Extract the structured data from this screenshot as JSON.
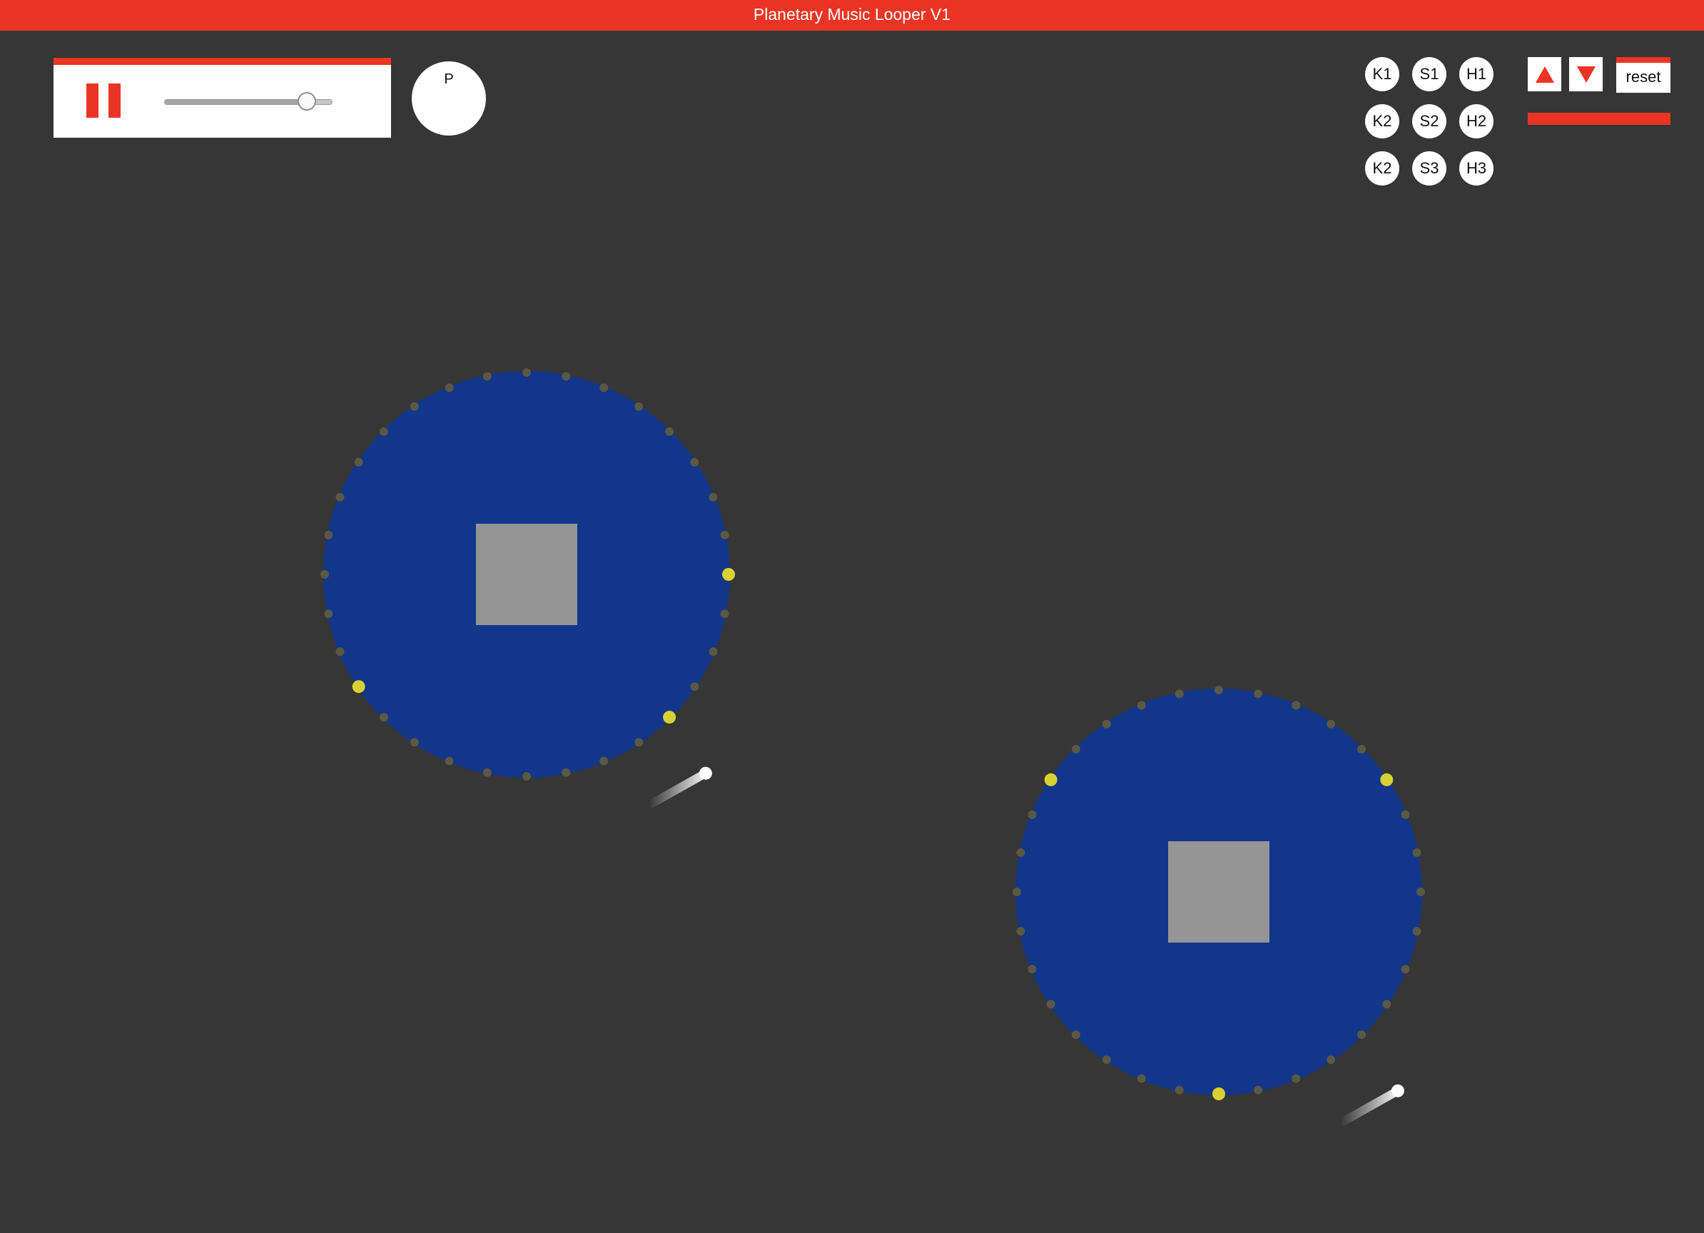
{
  "app": {
    "title": "Planetary Music Looper V1"
  },
  "colors": {
    "accent": "#ea3524",
    "background": "#363636",
    "planet": "#11368a",
    "core": "#959595",
    "note_active": "#d9d131",
    "note_slot": "#5b5843",
    "comet": "#ffffff"
  },
  "transport": {
    "pause_icon": "pause-icon",
    "tempo_value": 0.85
  },
  "controls": {
    "p_label": "P",
    "up_icon": "triangle-up-icon",
    "down_icon": "triangle-down-icon",
    "reset_label": "reset",
    "level_value": 1.0
  },
  "samples": {
    "rows": [
      [
        "K1",
        "S1",
        "H1"
      ],
      [
        "K2",
        "S2",
        "H2"
      ],
      [
        "K2",
        "S3",
        "H3"
      ]
    ]
  },
  "planets": [
    {
      "name": "planet-1",
      "slot_count": 32,
      "active_notes": [
        8,
        12,
        21
      ],
      "comet_angle_deg": 138
    },
    {
      "name": "planet-2",
      "slot_count": 32,
      "active_notes": [
        5,
        16,
        27
      ],
      "comet_angle_deg": 138
    }
  ]
}
